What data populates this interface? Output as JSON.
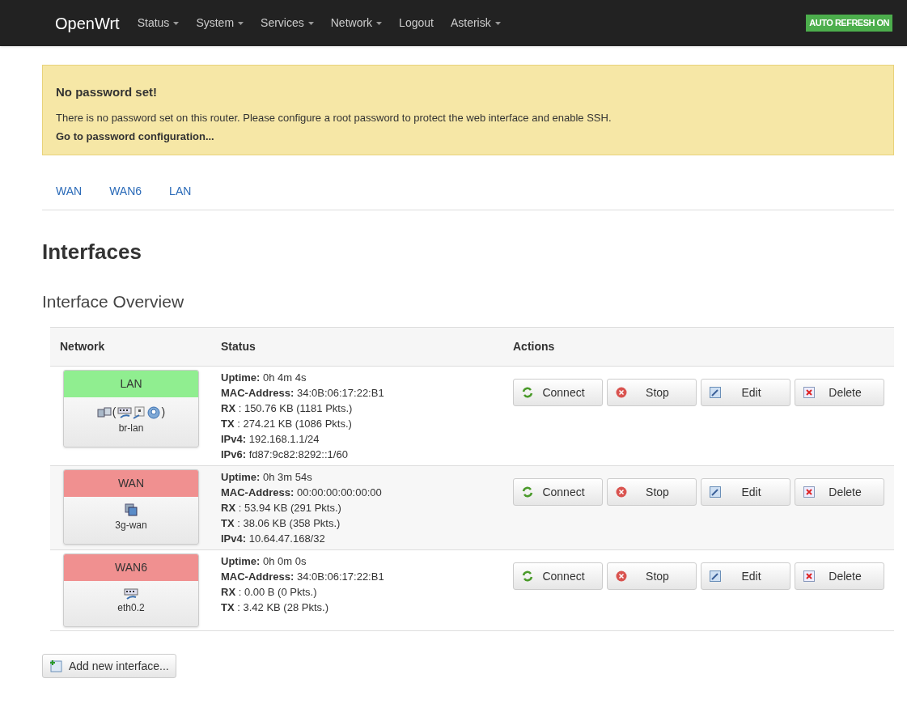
{
  "navbar": {
    "brand": "OpenWrt",
    "menu": [
      {
        "label": "Status",
        "dropdown": true
      },
      {
        "label": "System",
        "dropdown": true
      },
      {
        "label": "Services",
        "dropdown": true
      },
      {
        "label": "Network",
        "dropdown": true
      },
      {
        "label": "Logout",
        "dropdown": false
      },
      {
        "label": "Asterisk",
        "dropdown": true
      }
    ],
    "badge": "AUTO REFRESH ON"
  },
  "alert": {
    "title": "No password set!",
    "message": "There is no password set on this router. Please configure a root password to protect the web interface and enable SSH.",
    "link": "Go to password configuration..."
  },
  "tabs": [
    {
      "label": "WAN"
    },
    {
      "label": "WAN6"
    },
    {
      "label": "LAN"
    }
  ],
  "heading": "Interfaces",
  "subheading": "Interface Overview",
  "table": {
    "columns": [
      "Network",
      "Status",
      "Actions"
    ],
    "rows": [
      {
        "name": "LAN",
        "color": "#90ee90",
        "devices": [
          {
            "kind": "bridge"
          },
          {
            "kind": "paren",
            "text": "("
          },
          {
            "kind": "ethernet"
          },
          {
            "kind": "port"
          },
          {
            "kind": "wireless"
          },
          {
            "kind": "paren",
            "text": ")"
          }
        ],
        "device": "br-lan",
        "status": [
          {
            "label": "Uptime:",
            "value": "0h 4m 4s"
          },
          {
            "label": "MAC-Address:",
            "value": "34:0B:06:17:22:B1"
          },
          {
            "label": "RX",
            "value": ": 150.76 KB (1181 Pkts.)"
          },
          {
            "label": "TX",
            "value": ": 274.21 KB (1086 Pkts.)"
          },
          {
            "label": "IPv4:",
            "value": "192.168.1.1/24"
          },
          {
            "label": "IPv6:",
            "value": "fd87:9c82:8292::1/60"
          }
        ],
        "actions": [
          {
            "kind": "connect",
            "label": "Connect"
          },
          {
            "kind": "stop",
            "label": "Stop"
          },
          {
            "kind": "edit",
            "label": "Edit"
          },
          {
            "kind": "delete",
            "label": "Delete"
          }
        ]
      },
      {
        "name": "WAN",
        "color": "#f09090",
        "devices": [
          {
            "kind": "modem"
          }
        ],
        "device": "3g-wan",
        "status": [
          {
            "label": "Uptime:",
            "value": "0h 3m 54s"
          },
          {
            "label": "MAC-Address:",
            "value": "00:00:00:00:00:00"
          },
          {
            "label": "RX",
            "value": ": 53.94 KB (291 Pkts.)"
          },
          {
            "label": "TX",
            "value": ": 38.06 KB (358 Pkts.)"
          },
          {
            "label": "IPv4:",
            "value": "10.64.47.168/32"
          }
        ],
        "actions": [
          {
            "kind": "connect",
            "label": "Connect"
          },
          {
            "kind": "stop",
            "label": "Stop"
          },
          {
            "kind": "edit",
            "label": "Edit"
          },
          {
            "kind": "delete",
            "label": "Delete"
          }
        ]
      },
      {
        "name": "WAN6",
        "color": "#f09090",
        "devices": [
          {
            "kind": "ethernet"
          }
        ],
        "device": "eth0.2",
        "status": [
          {
            "label": "Uptime:",
            "value": "0h 0m 0s"
          },
          {
            "label": "MAC-Address:",
            "value": "34:0B:06:17:22:B1"
          },
          {
            "label": "RX",
            "value": ": 0.00 B (0 Pkts.)"
          },
          {
            "label": "TX",
            "value": ": 3.42 KB (28 Pkts.)"
          }
        ],
        "actions": [
          {
            "kind": "connect",
            "label": "Connect"
          },
          {
            "kind": "stop",
            "label": "Stop"
          },
          {
            "kind": "edit",
            "label": "Edit"
          },
          {
            "kind": "delete",
            "label": "Delete"
          }
        ]
      }
    ]
  },
  "add_button": "Add new interface..."
}
